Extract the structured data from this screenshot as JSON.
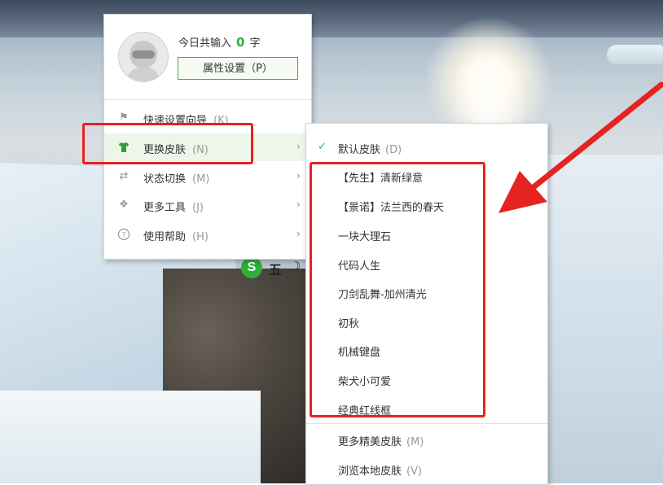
{
  "ime": {
    "logo_letter": "S",
    "mode_char": "五",
    "moon_glyph": "☽"
  },
  "main_menu": {
    "count_prefix": "今日共输入",
    "count_value": "0",
    "count_suffix": "字",
    "property_button": "属性设置（P）",
    "items": [
      {
        "icon": "flag-icon",
        "label": "快速设置向导",
        "hotkey": "(K)",
        "has_submenu": false
      },
      {
        "icon": "shirt-icon",
        "label": "更换皮肤",
        "hotkey": "(N)",
        "has_submenu": true,
        "highlighted": true
      },
      {
        "icon": "switch-icon",
        "label": "状态切换",
        "hotkey": "(M)",
        "has_submenu": true
      },
      {
        "icon": "tools-icon",
        "label": "更多工具",
        "hotkey": "(J)",
        "has_submenu": true
      },
      {
        "icon": "help-icon",
        "label": "使用帮助",
        "hotkey": "(H)",
        "has_submenu": true
      }
    ]
  },
  "skin_menu": {
    "default_skin": {
      "label": "默认皮肤",
      "hotkey": "(D)",
      "checked": true
    },
    "skins": [
      "【先生】清新绿意",
      "【景诺】法兰西的春天",
      "一块大理石",
      "代码人生",
      "刀剑乱舞-加州清光",
      "初秋",
      "机械键盘",
      "柴犬小可爱",
      "经典红线框"
    ],
    "more_skins": {
      "label": "更多精美皮肤",
      "hotkey": "(M)"
    },
    "local_skins": {
      "label": "浏览本地皮肤",
      "hotkey": "(V)"
    }
  },
  "colors": {
    "accent_green": "#2fae3a",
    "annotation_red": "#e62222"
  }
}
